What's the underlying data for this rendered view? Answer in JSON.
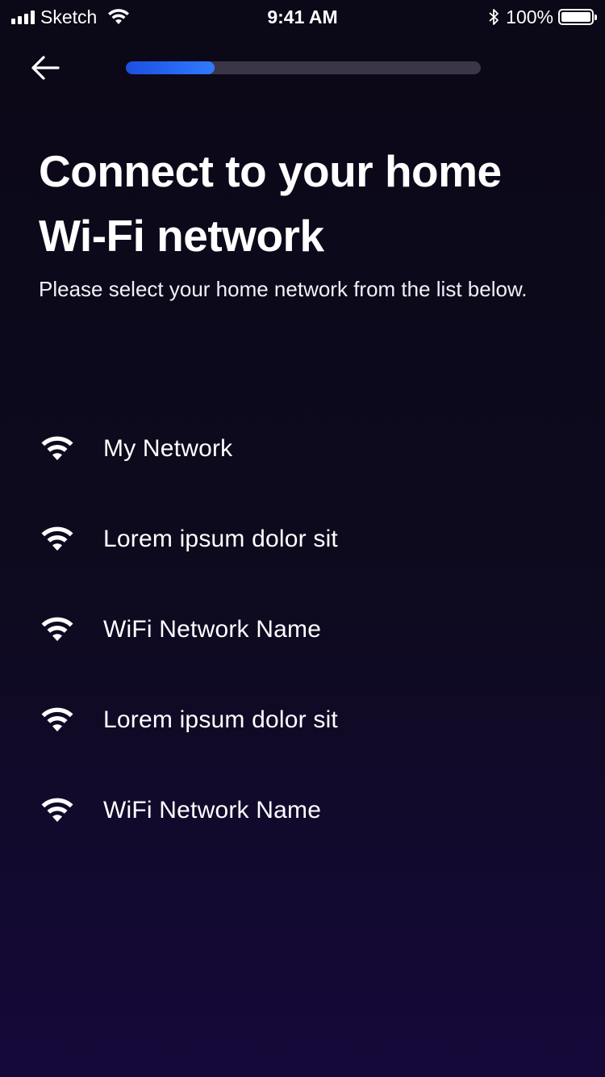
{
  "status_bar": {
    "carrier": "Sketch",
    "time": "9:41 AM",
    "battery": "100%"
  },
  "nav": {
    "back_icon": "arrow-left-icon",
    "progress": 0.25
  },
  "header": {
    "title": "Connect to your home Wi-Fi network",
    "subtitle": "Please select your home network from the list below."
  },
  "networks": [
    {
      "name": "My Network",
      "icon": "wifi-icon"
    },
    {
      "name": "Lorem ipsum dolor sit",
      "icon": "wifi-icon"
    },
    {
      "name": "WiFi Network Name",
      "icon": "wifi-icon"
    },
    {
      "name": "Lorem ipsum dolor sit",
      "icon": "wifi-icon"
    },
    {
      "name": "WiFi Network Name",
      "icon": "wifi-icon"
    }
  ],
  "colors": {
    "background_top": "#0b0817",
    "background_bottom": "#15093a",
    "progress_fill": "#2f7bff",
    "progress_track": "#3a3648",
    "text": "#ffffff"
  }
}
